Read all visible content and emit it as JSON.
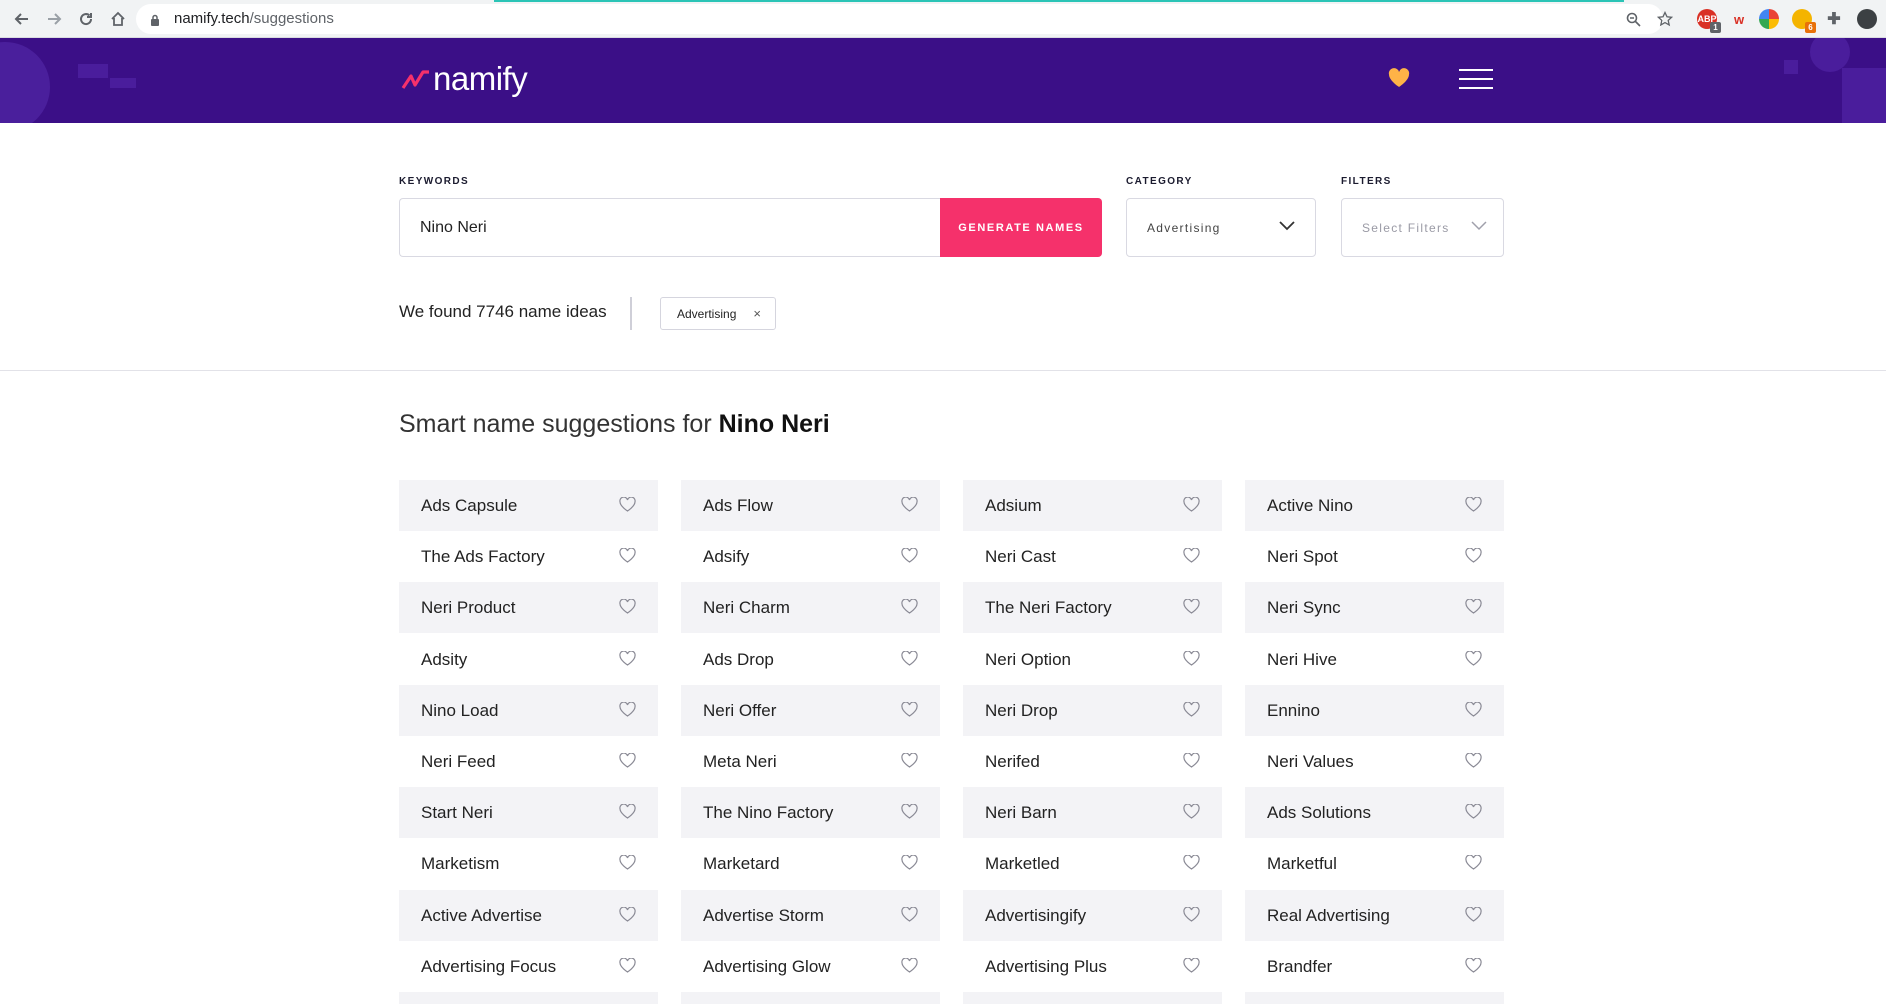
{
  "browser": {
    "url_host": "namify.tech",
    "url_path": "/suggestions",
    "extension_badges": [
      "1",
      "6"
    ],
    "extension_label": "ABP"
  },
  "site": {
    "logo_text": "namify",
    "accent_color": "#f5316b",
    "header_color": "#3b0f87"
  },
  "search": {
    "keywords_label": "KEYWORDS",
    "keywords_value": "Nino Neri",
    "generate_label": "GENERATE NAMES",
    "category_label": "CATEGORY",
    "category_value": "Advertising",
    "filters_label": "FILTERS",
    "filters_placeholder": "Select Filters"
  },
  "results": {
    "found_text": "We found 7746 name ideas",
    "chip_label": "Advertising",
    "chip_close": "×",
    "heading_prefix": "Smart name suggestions for ",
    "heading_name": "Nino Neri"
  },
  "names": [
    [
      "Ads Capsule",
      "Ads Flow",
      "Adsium",
      "Active Nino"
    ],
    [
      "The Ads Factory",
      "Adsify",
      "Neri Cast",
      "Neri Spot"
    ],
    [
      "Neri Product",
      "Neri Charm",
      "The Neri Factory",
      "Neri Sync"
    ],
    [
      "Adsity",
      "Ads Drop",
      "Neri Option",
      "Neri Hive"
    ],
    [
      "Nino Load",
      "Neri Offer",
      "Neri Drop",
      "Ennino"
    ],
    [
      "Neri Feed",
      "Meta Neri",
      "Nerifed",
      "Neri Values"
    ],
    [
      "Start Neri",
      "The Nino Factory",
      "Neri Barn",
      "Ads Solutions"
    ],
    [
      "Marketism",
      "Marketard",
      "Marketled",
      "Marketful"
    ],
    [
      "Active Advertise",
      "Advertise Storm",
      "Advertisingify",
      "Real Advertising"
    ],
    [
      "Advertising Focus",
      "Advertising Glow",
      "Advertising Plus",
      "Brandfer"
    ]
  ]
}
